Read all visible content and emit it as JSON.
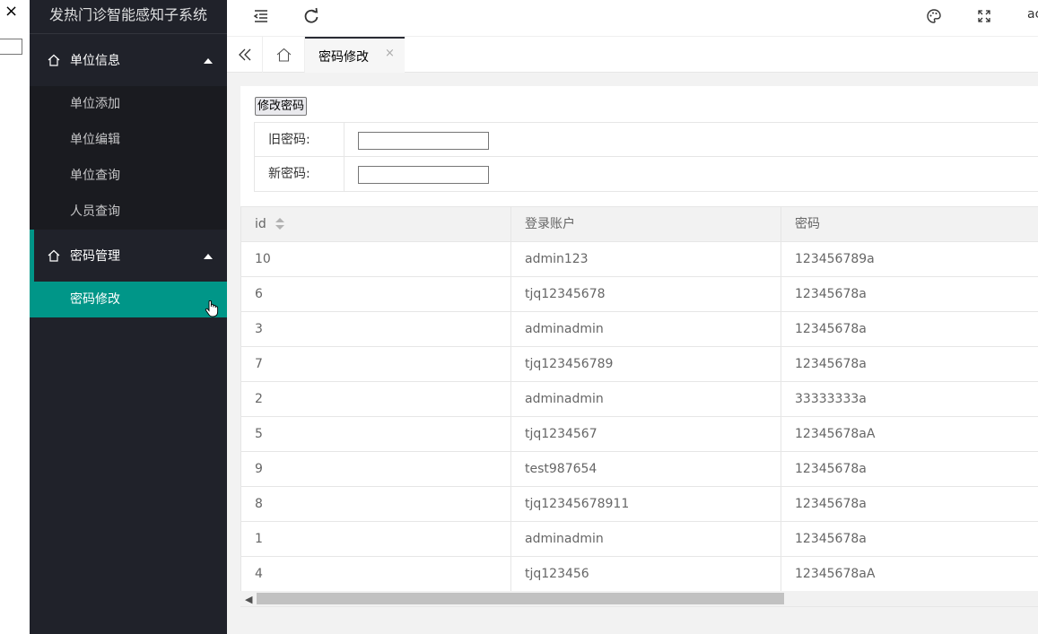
{
  "app": {
    "title": "发热门诊智能感知子系统"
  },
  "header": {
    "user_label": "ac"
  },
  "sidebar": {
    "groups": [
      {
        "label": "单位信息",
        "children": [
          "单位添加",
          "单位编辑",
          "单位查询",
          "人员查询"
        ]
      },
      {
        "label": "密码管理",
        "children": [
          "密码修改"
        ]
      }
    ]
  },
  "tabs": {
    "current": {
      "label": "密码修改",
      "close": "×"
    }
  },
  "form": {
    "title": "修改密码",
    "old_label": "旧密码:",
    "new_label": "新密码:",
    "old_value": "",
    "new_value": ""
  },
  "table": {
    "columns": [
      "id",
      "登录账户",
      "密码"
    ],
    "rows": [
      [
        "10",
        "admin123",
        "123456789a"
      ],
      [
        "6",
        "tjq12345678",
        "12345678a"
      ],
      [
        "3",
        "adminadmin",
        "12345678a"
      ],
      [
        "7",
        "tjq123456789",
        "12345678a"
      ],
      [
        "2",
        "adminadmin",
        "33333333a"
      ],
      [
        "5",
        "tjq1234567",
        "12345678aA"
      ],
      [
        "9",
        "test987654",
        "12345678a"
      ],
      [
        "8",
        "tjq12345678911",
        "12345678a"
      ],
      [
        "1",
        "adminadmin",
        "12345678a"
      ],
      [
        "4",
        "tjq123456",
        "12345678aA"
      ]
    ]
  },
  "strip": {
    "close": "×"
  },
  "colors": {
    "sidebar_bg": "#20222a",
    "accent": "#009688"
  }
}
